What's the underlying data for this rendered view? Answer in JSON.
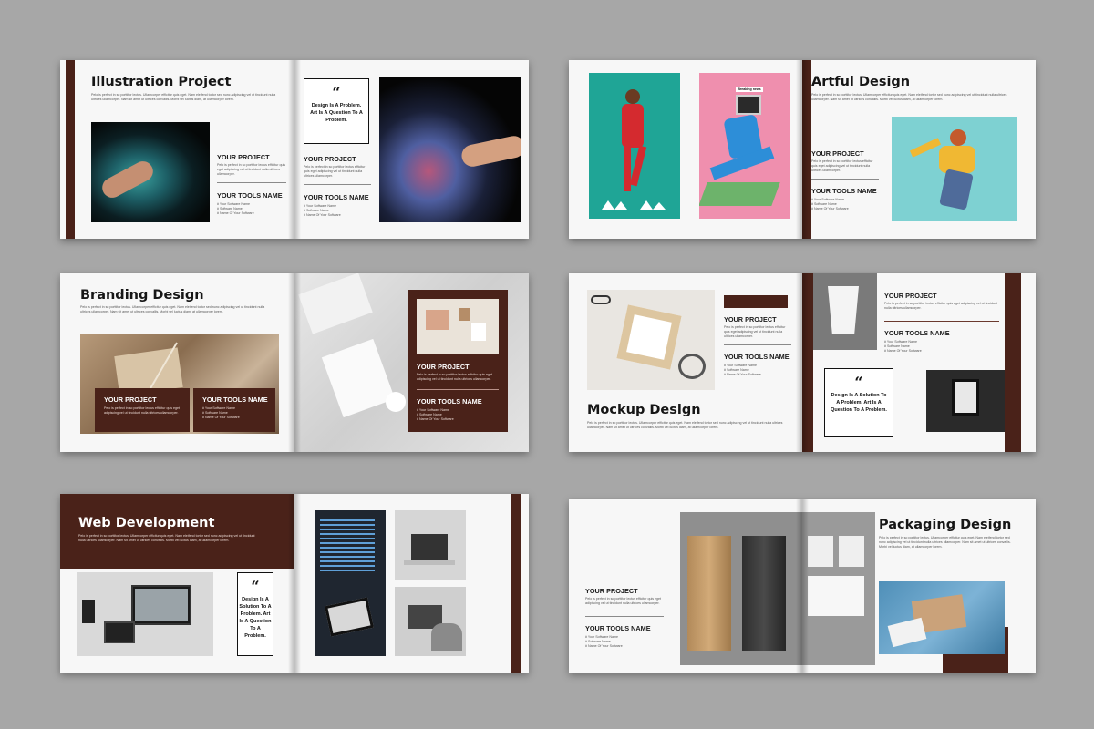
{
  "common": {
    "paragraph": "Pelo is perfect in so porttitor lectus. Ullamcorper efficitur quis eget. Nam eleifend tortor sed nunc adipiscing vel ut tincidunt nulla ultrices ullamcorper. Nam sit amet ut ultrices convallis. Morbi vel luctus diam, at ullamcorper lorem.",
    "short_paragraph": "Pelo is perfect in so porttitor lectus efficitur quis eget adipiscing vel ut tincidunt nulla ultrices ullamcorper.",
    "your_project": "YOUR PROJECT",
    "your_tools_name": "YOUR TOOLS NAME",
    "tools_list": "# Your Software Name\n# Software Name\n# Name Of Your Software",
    "quote_mark": "“"
  },
  "spreads": {
    "s1": {
      "title": "Illustration Project",
      "quote": "Design Is A Problem. Art Is A Question To A Problem."
    },
    "s2": {
      "title": "Artful Design",
      "badge": "Breaking news"
    },
    "s3": {
      "title": "Branding Design"
    },
    "s4": {
      "title": "Mockup Design",
      "quote": "Design Is A Solution To A Problem. Art Is A Question To A Problem."
    },
    "s5": {
      "title": "Web Development",
      "quote": "Design Is A Solution To A Problem. Art Is A Question To A Problem."
    },
    "s6": {
      "title": "Packaging Design"
    }
  },
  "colors": {
    "accent_brown": "#4a2219",
    "background": "#a7a7a7",
    "page": "#f7f7f7"
  }
}
